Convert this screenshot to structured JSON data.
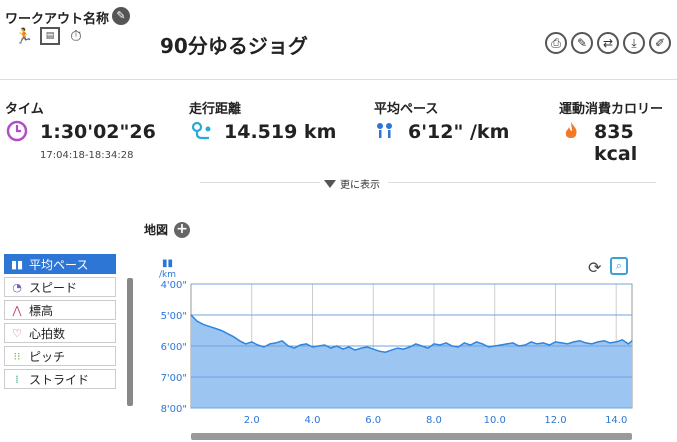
{
  "header": {
    "workout_label": "ワークアウト名称",
    "title": "90分ゆるジョグ",
    "type_icons": [
      "running-icon",
      "film-icon",
      "stopwatch-icon"
    ],
    "actions": [
      "print-icon",
      "edit-icon",
      "swap-icon",
      "download-icon",
      "pen-icon"
    ]
  },
  "metrics": {
    "time": {
      "label": "タイム",
      "value": "1:30'02\"26",
      "sub": "17:04:18-18:34:28",
      "icon": "clock-icon"
    },
    "distance": {
      "label": "走行距離",
      "value": "14.519 km",
      "icon": "route-icon"
    },
    "pace": {
      "label": "平均ペース",
      "value": "6'12\" /km",
      "icon": "pace-icon"
    },
    "calories": {
      "label": "運動消費カロリー",
      "value": "835 kcal",
      "icon": "flame-icon"
    }
  },
  "more": {
    "label": "更に表示"
  },
  "map": {
    "label": "地図"
  },
  "menu": [
    {
      "label": "平均ペース",
      "icon": "pace-icon",
      "active": true
    },
    {
      "label": "スピード",
      "icon": "speedometer-icon",
      "active": false
    },
    {
      "label": "標高",
      "icon": "elevation-icon",
      "active": false
    },
    {
      "label": "心拍数",
      "icon": "heart-icon",
      "active": false
    },
    {
      "label": "ピッチ",
      "icon": "footsteps-icon",
      "active": false
    },
    {
      "label": "ストライド",
      "icon": "stride-icon",
      "active": false
    }
  ],
  "chart_unit": "/km",
  "chart_data": {
    "type": "area",
    "ylabel": "/km",
    "y_tick_labels": [
      "4'00\"",
      "5'00\"",
      "6'00\"",
      "7'00\"",
      "8'00\""
    ],
    "ylim_seconds_per_km": [
      240,
      480
    ],
    "y_inverted": true,
    "x_tick_labels": [
      "2.0",
      "4.0",
      "6.0",
      "8.0",
      "10.0",
      "12.0",
      "14.0"
    ],
    "xlim_km": [
      0,
      14.52
    ],
    "grid": true,
    "colors": {
      "fill": "#9dc5f2",
      "line": "#2f86e0"
    },
    "series": [
      {
        "x": [
          0,
          0.2,
          0.4,
          0.6,
          0.8,
          1.0,
          1.2,
          1.4,
          1.6,
          1.8,
          2.0,
          2.2,
          2.4,
          2.6,
          2.8,
          3.0,
          3.2,
          3.4,
          3.6,
          3.8,
          4.0,
          4.2,
          4.4,
          4.6,
          4.8,
          5.0,
          5.2,
          5.4,
          5.6,
          5.8,
          6.0,
          6.2,
          6.4,
          6.6,
          6.8,
          7.0,
          7.2,
          7.4,
          7.6,
          7.8,
          8.0,
          8.2,
          8.4,
          8.6,
          8.8,
          9.0,
          9.2,
          9.4,
          9.6,
          9.8,
          10.0,
          10.2,
          10.4,
          10.6,
          10.8,
          11.0,
          11.2,
          11.4,
          11.6,
          11.8,
          12.0,
          12.2,
          12.4,
          12.6,
          12.8,
          13.0,
          13.2,
          13.4,
          13.6,
          13.8,
          14.0,
          14.2,
          14.4,
          14.52
        ],
        "y": [
          300,
          312,
          318,
          322,
          326,
          330,
          336,
          342,
          350,
          356,
          352,
          358,
          362,
          356,
          354,
          350,
          360,
          364,
          358,
          356,
          362,
          360,
          358,
          364,
          360,
          366,
          362,
          368,
          364,
          362,
          366,
          370,
          372,
          368,
          364,
          366,
          362,
          356,
          360,
          364,
          356,
          358,
          354,
          360,
          362,
          354,
          358,
          352,
          356,
          362,
          360,
          358,
          356,
          354,
          360,
          358,
          352,
          356,
          354,
          358,
          352,
          354,
          356,
          352,
          350,
          354,
          356,
          352,
          350,
          354,
          352,
          348,
          356,
          350
        ]
      }
    ]
  }
}
